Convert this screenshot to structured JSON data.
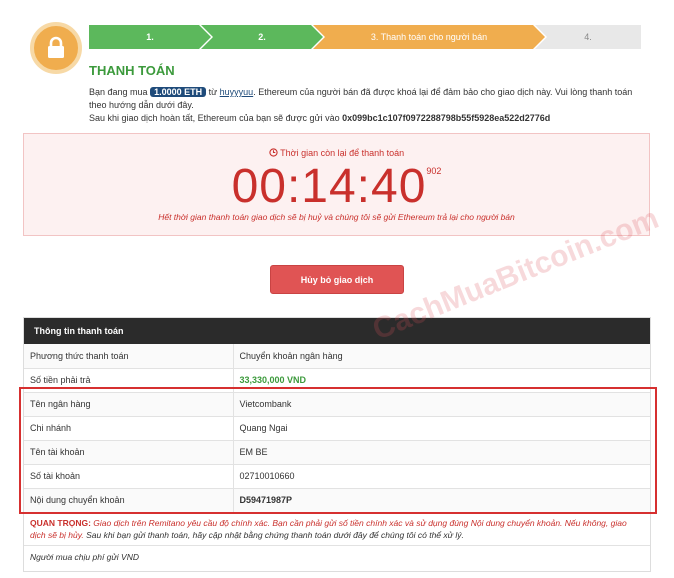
{
  "colors": {
    "green": "#5cb85c",
    "orange": "#f0ad4e",
    "red": "#c9302c",
    "navy": "#1f4b7a"
  },
  "icon": "lock-icon",
  "steps": [
    {
      "label": "1.",
      "state": "done"
    },
    {
      "label": "2.",
      "state": "done"
    },
    {
      "label": "3. Thanh toán cho người bán",
      "state": "current"
    },
    {
      "label": "4.",
      "state": "pending"
    }
  ],
  "heading": "THANH TOÁN",
  "description": {
    "prefix": "Bạn đang mua",
    "amount": "1.0000 ETH",
    "from": "từ",
    "seller": "huyyyuu",
    "rest": ". Ethereum của người bán đã được khoá lại để đảm bảo cho giao dịch này. Vui lòng thanh toán theo hướng dẫn dưới đây.",
    "line2_prefix": "Sau khi giao dịch hoàn tất, Ethereum của bạn sẽ được gửi vào",
    "address": "0x099bc1c107f0972288798b55f5928ea522d2776d"
  },
  "timer": {
    "label": "Thời gian còn lại để thanh toán",
    "time": "00:14:40",
    "ms": "902",
    "note": "Hết thời gian thanh toán giao dịch sẽ bị huỷ và chúng tôi sẽ gửi Ethereum trả lại cho người bán"
  },
  "cancel_label": "Hủy bỏ giao dịch",
  "watermark": "CachMuaBitcoin.com",
  "payment": {
    "title": "Thông tin thanh toán",
    "rows": [
      {
        "key": "Phương thức thanh toán",
        "value": "Chuyển khoản ngân hàng"
      },
      {
        "key": "Số tiền phải trả",
        "value": "33,330,000 VND"
      },
      {
        "key": "Tên ngân hàng",
        "value": "Vietcombank"
      },
      {
        "key": "Chi nhánh",
        "value": "Quang Ngai"
      },
      {
        "key": "Tên tài khoản",
        "value": "EM BE"
      },
      {
        "key": "Số tài khoản",
        "value": "02710010660"
      },
      {
        "key": "Nội dung chuyển khoản",
        "value": "D59471987P"
      }
    ],
    "important_label": "QUAN TRỌNG:",
    "important_red": "Giao dịch trên Remitano yêu cầu độ chính xác. Bạn cần phải gửi số tiền chính xác và sử dụng đúng Nội dung chuyển khoản. Nếu không, giao dịch sẽ bị hủy.",
    "important_rest": "Sau khi bạn gửi thanh toán, hãy cập nhật bằng chứng thanh toán dưới đây để chúng tôi có thể xử lý.",
    "fee_note": "Người mua chịu phí gửi VND"
  }
}
